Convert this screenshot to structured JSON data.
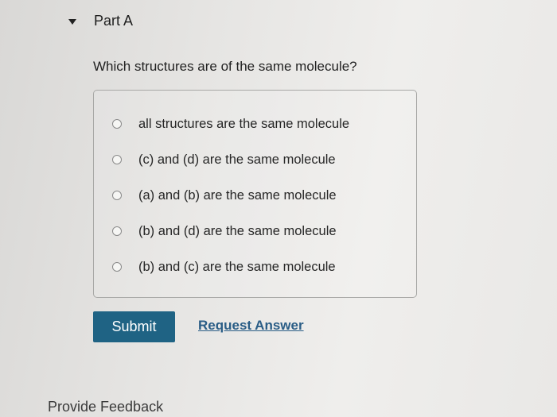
{
  "part": {
    "title": "Part A",
    "toggle_icon": "caret-down-icon"
  },
  "question": {
    "text": "Which structures are of the same molecule?"
  },
  "options": [
    {
      "label": "all structures are the same molecule",
      "selected": false
    },
    {
      "label": "(c) and (d) are the same molecule",
      "selected": false
    },
    {
      "label": "(a) and (b) are the same molecule",
      "selected": false
    },
    {
      "label": "(b) and (d) are the same molecule",
      "selected": false
    },
    {
      "label": "(b) and (c) are the same molecule",
      "selected": false
    }
  ],
  "actions": {
    "submit_label": "Submit",
    "request_answer_label": "Request Answer"
  },
  "footer": {
    "feedback_label": "Provide Feedback"
  },
  "colors": {
    "submit_bg": "#1f6384",
    "link": "#2a5d86"
  }
}
